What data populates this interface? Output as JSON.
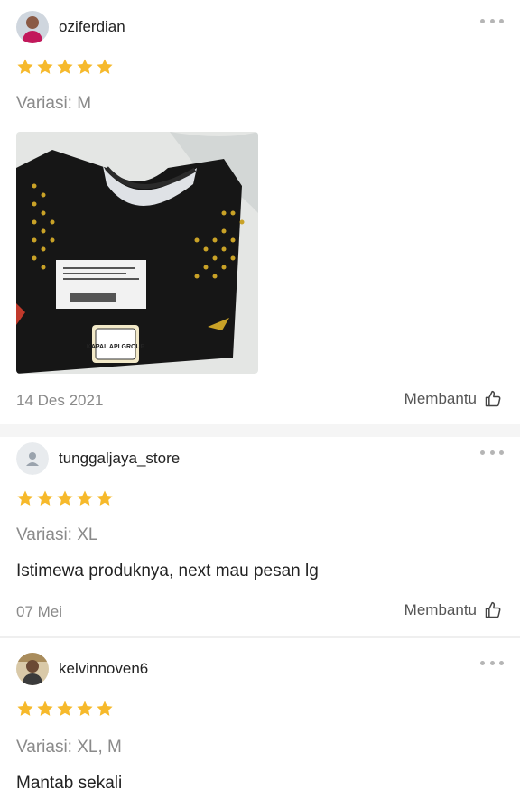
{
  "reviews": [
    {
      "username": "oziferdian",
      "rating": 5,
      "variasi": "Variasi: M",
      "comment": "",
      "photo": {
        "alt": "black jersey with gold dots",
        "label_text": "KAPAL API GROUP"
      },
      "date": "14 Des 2021",
      "helpful_label": "Membantu"
    },
    {
      "username": "tunggaljaya_store",
      "rating": 5,
      "variasi": "Variasi: XL",
      "comment": "Istimewa produknya, next mau pesan lg",
      "date": "07 Mei",
      "helpful_label": "Membantu"
    },
    {
      "username": "kelvinnoven6",
      "rating": 5,
      "variasi": "Variasi: XL, M",
      "comment": "Mantab sekali"
    }
  ],
  "colors": {
    "star": "#f6b92b",
    "muted_text": "#8a8a8a",
    "divider": "#f5f5f5"
  }
}
